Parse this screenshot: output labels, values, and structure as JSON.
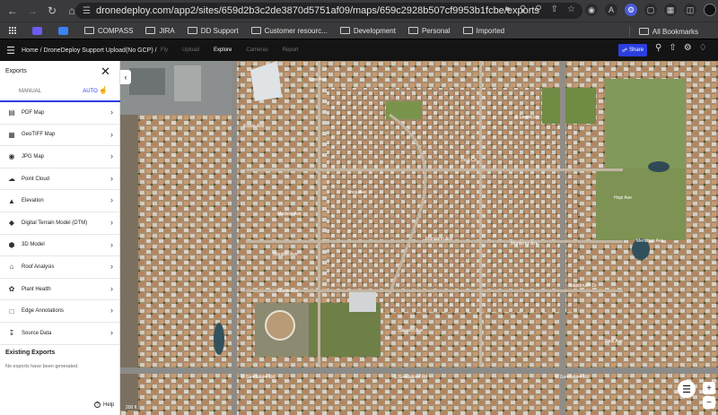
{
  "browser": {
    "url_text": "dronedeploy.com/app2/sites/659d2b3c2de3870d5751af09/maps/659c2928b507cf9953b1fcbe/exports",
    "bookmarks": [
      {
        "label": "COMPASS",
        "kind": "folder"
      },
      {
        "label": "JIRA",
        "kind": "folder"
      },
      {
        "label": "DD Support",
        "kind": "folder"
      },
      {
        "label": "Customer resourc...",
        "kind": "folder"
      },
      {
        "label": "Development",
        "kind": "folder"
      },
      {
        "label": "Personal",
        "kind": "folder"
      },
      {
        "label": "Imported",
        "kind": "folder"
      }
    ],
    "all_bookmarks": "All Bookmarks"
  },
  "header": {
    "breadcrumb": "Home / DroneDeploy Support Upload(No GCP) /",
    "tabs": [
      {
        "label": "Fly",
        "active": false
      },
      {
        "label": "Upload",
        "active": false
      },
      {
        "label": "Explore",
        "active": true
      },
      {
        "label": "Cameras",
        "active": false
      },
      {
        "label": "Report",
        "active": false
      }
    ],
    "share_label": "Share"
  },
  "sidebar": {
    "title": "Exports",
    "tab_manual": "MANUAL",
    "tab_auto": "AUTO",
    "items": [
      {
        "label": "PDF Map",
        "icon": "pdf-icon"
      },
      {
        "label": "GeoTIFF Map",
        "icon": "geotiff-icon"
      },
      {
        "label": "JPG Map",
        "icon": "camera-icon"
      },
      {
        "label": "Point Cloud",
        "icon": "cloud-icon"
      },
      {
        "label": "Elevation",
        "icon": "mountain-icon"
      },
      {
        "label": "Digital Terrain Model (DTM)",
        "icon": "dtm-icon"
      },
      {
        "label": "3D Model",
        "icon": "cube-icon"
      },
      {
        "label": "Roof Analysis",
        "icon": "roof-icon"
      },
      {
        "label": "Plant Health",
        "icon": "leaf-icon"
      },
      {
        "label": "Edge Annotations",
        "icon": "edge-icon"
      },
      {
        "label": "Source Data",
        "icon": "download-icon"
      }
    ],
    "existing_title": "Existing Exports",
    "existing_empty": "No exports have been generated.",
    "help_label": "Help"
  },
  "map": {
    "scale_label": "200 ft",
    "streets": [
      "Kiva Ave",
      "Kiowa Ave",
      "Inca Ave",
      "Hopi Ave",
      "Madero Ave",
      "Mandarin Ave",
      "Marable Ave",
      "Monterey Ave",
      "Monte Ave",
      "Navarro Ave",
      "Neal Ave",
      "Mendoza Ave",
      "E Guadalupe Rd",
      "E Laurel St",
      "Inca Cir",
      "Sagebrush Dr"
    ]
  }
}
